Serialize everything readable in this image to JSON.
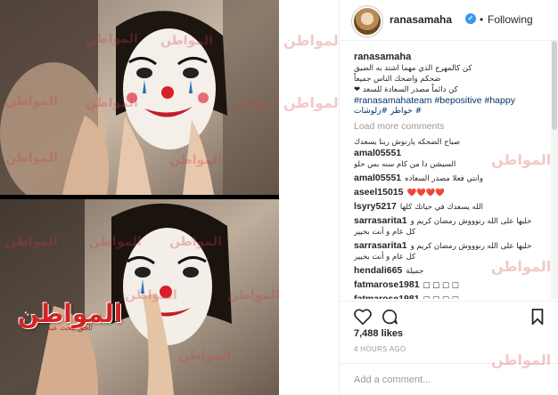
{
  "watermark": {
    "text": "المواطن",
    "color": "#d12424"
  },
  "brand_logo": {
    "name": "المواطن",
    "tagline": "الحق نبحث عنه"
  },
  "post": {
    "username": "ranasamaha",
    "verified_icon": "verified-badge-icon",
    "separator": "•",
    "follow_status": "Following",
    "caption": {
      "username": "ranasamaha",
      "lines": [
        "كن كالمهرج الذي مهما اشتد به الضيق",
        "ضحكم واضحك الناس جميعاً",
        "كن دائماً مصدر السعادة للسعد ❤"
      ],
      "hashtags": "#ranasamahateam #bepositive #happy",
      "hashtags_ar": "خواطر #زلوشات #"
    },
    "load_more": "Load more comments",
    "comments": [
      {
        "user": "amal05551",
        "text": "صباح الضحكه يارنوش ربنا يسعدك",
        "text2": "السيشن دا من كام سنه بس حلو"
      },
      {
        "user": "amal05551",
        "text": "وانتي فعلا مصدر السعاده",
        "inline": true
      },
      {
        "user": "aseel15015",
        "text": "❤️❤️❤️❤️",
        "inline": true
      },
      {
        "user": "lsyry5217",
        "text": "الله يسعدك في حياتك كلها",
        "inline": true
      },
      {
        "user": "sarrasarita1",
        "text": "خليها على الله رنوووش رمضان كريم و",
        "text2": "كل عام و أنت بخيير"
      },
      {
        "user": "sarrasarita1",
        "text": "خليها على الله رنوووش رمضان كريم و",
        "text2": "كل عام و أنت بخيير"
      },
      {
        "user": "hendali665",
        "text": "جميلة",
        "inline": true
      },
      {
        "user": "fatmarose1981",
        "text": "□ □ □ □",
        "inline": true
      },
      {
        "user": "fatmarose1981",
        "text": "□ □ □ □",
        "inline": true
      }
    ],
    "actions": {
      "like": "heart-icon",
      "comment": "comment-icon",
      "save": "bookmark-icon"
    },
    "likes": "7,488 likes",
    "time": "4 HOURS AGO",
    "add_comment_placeholder": "Add a comment..."
  },
  "colors": {
    "link": "#003569",
    "muted": "#999999",
    "text": "#262626",
    "verified": "#3897f0",
    "border": "#efefef"
  }
}
